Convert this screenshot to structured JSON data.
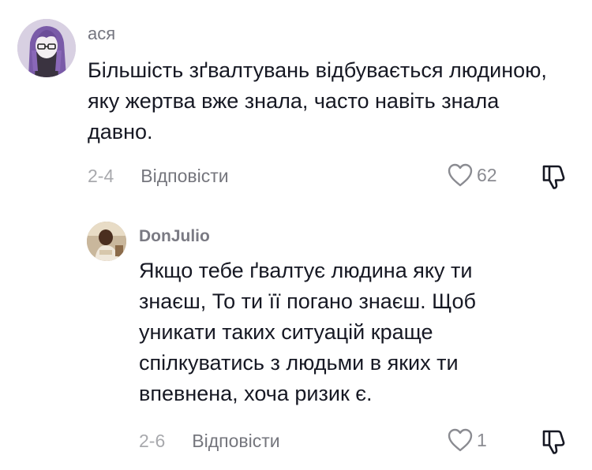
{
  "comments": [
    {
      "username": "ася",
      "text": "Більшість зґвалтувань відбувається людиною, яку жертва вже знала, часто навіть знала давно.",
      "date": "2-4",
      "reply_label": "Відповісти",
      "likes": "62",
      "avatar_icon": "anime-avatar-purple-hair",
      "like_icon": "heart-outline-icon",
      "dislike_icon": "thumbs-down-outline-icon"
    },
    {
      "username": "DonJulio",
      "text": "Якщо тебе ґвалтує людина яку ти знаєш, То ти її погано знаєш. Щоб уникати таких ситуацій краще спілкуватись з людьми в яких ти впевнена, хоча ризик є.",
      "date": "2-6",
      "reply_label": "Відповісти",
      "likes": "1",
      "avatar_icon": "child-photo-avatar",
      "like_icon": "heart-outline-icon",
      "dislike_icon": "thumbs-down-outline-icon"
    }
  ],
  "colors": {
    "text": "#161823",
    "secondary": "#8a8b91",
    "date": "#a8a9ad",
    "background": "#ffffff"
  }
}
